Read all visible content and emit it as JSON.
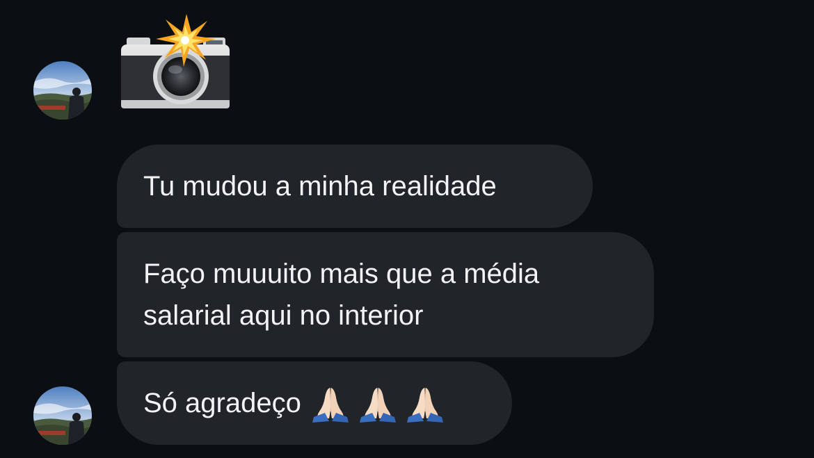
{
  "conversation": {
    "messages": [
      {
        "type": "sticker",
        "icon": "camera-flash-icon"
      },
      {
        "type": "text",
        "lines": [
          "Tu mudou a minha realidade"
        ]
      },
      {
        "type": "text",
        "lines": [
          "Faço muuuito mais que a média",
          "salarial aqui no interior"
        ]
      },
      {
        "type": "text",
        "lines": [
          "Só agradeço"
        ],
        "emoji": [
          "folded-hands-icon",
          "folded-hands-icon",
          "folded-hands-icon"
        ]
      }
    ]
  },
  "colors": {
    "background": "#0b0e12",
    "bubble": "#212429",
    "text": "#f2f3f5"
  }
}
